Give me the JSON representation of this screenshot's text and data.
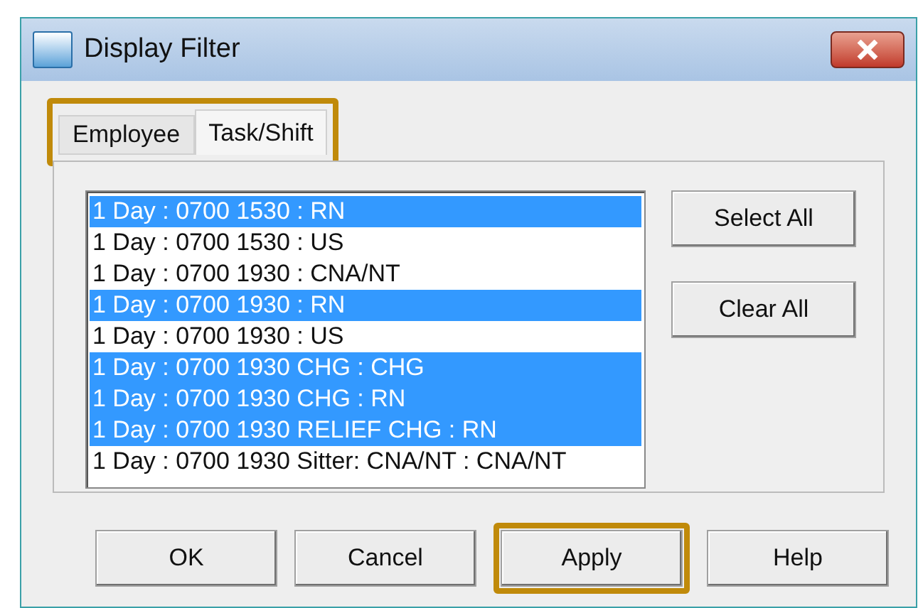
{
  "window": {
    "title": "Display Filter"
  },
  "tabs_highlighted": true,
  "tabs": [
    {
      "label": "Employee",
      "selected": false
    },
    {
      "label": "Task/Shift",
      "selected": true
    }
  ],
  "list_items": [
    {
      "label": "1 Day : 0700 1530 : RN",
      "selected": true
    },
    {
      "label": "1 Day : 0700 1530 : US",
      "selected": false
    },
    {
      "label": "1 Day : 0700 1930 : CNA/NT",
      "selected": false
    },
    {
      "label": "1 Day : 0700 1930 : RN",
      "selected": true
    },
    {
      "label": "1 Day : 0700 1930 : US",
      "selected": false
    },
    {
      "label": "1 Day : 0700 1930 CHG : CHG",
      "selected": true
    },
    {
      "label": "1 Day : 0700 1930 CHG : RN",
      "selected": true
    },
    {
      "label": "1 Day : 0700 1930 RELIEF CHG : RN",
      "selected": true
    },
    {
      "label": "1 Day : 0700 1930 Sitter: CNA/NT : CNA/NT",
      "selected": false
    }
  ],
  "side_buttons": [
    "Select All",
    "Clear All"
  ],
  "buttons": [
    {
      "label": "OK",
      "highlighted": false
    },
    {
      "label": "Cancel",
      "highlighted": false
    },
    {
      "label": "Apply",
      "highlighted": true
    },
    {
      "label": "Help",
      "highlighted": false
    }
  ]
}
